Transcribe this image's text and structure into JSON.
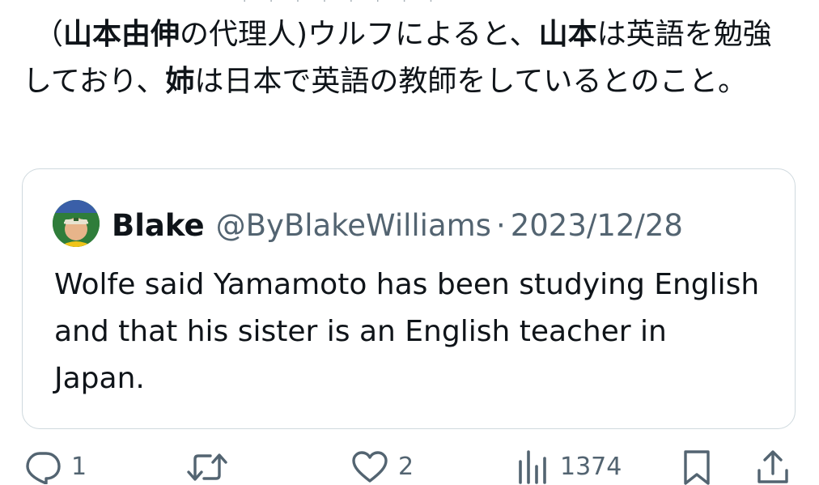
{
  "tweet": {
    "text_prefix": "（",
    "bold_name": "山本由伸",
    "text_1": "の代理人)ウルフによると、",
    "bold_yamamoto": "山本",
    "text_2": "は英語",
    "text_3": "を勉強しており、",
    "bold_sister": "姉",
    "text_4": "は日本で英語の教師をしてい",
    "text_5": "るとのこと。"
  },
  "quote": {
    "display_name": "Blake",
    "handle": "@ByBlakeWilliams",
    "separator": "·",
    "date": "2023/12/28",
    "body": "Wolfe said Yamamoto has been studying English and that his sister is an English teacher in Japan.",
    "avatar_icon": "profile-photo-avatar"
  },
  "actions": {
    "reply_count": "1",
    "repost_count": "",
    "like_count": "2",
    "views_count": "1374",
    "icons": [
      "reply-icon",
      "repost-icon",
      "like-icon",
      "views-icon",
      "bookmark-icon",
      "share-icon"
    ]
  },
  "colors": {
    "text_primary": "#0f1419",
    "text_secondary": "#536471",
    "border": "#cfd9de"
  }
}
